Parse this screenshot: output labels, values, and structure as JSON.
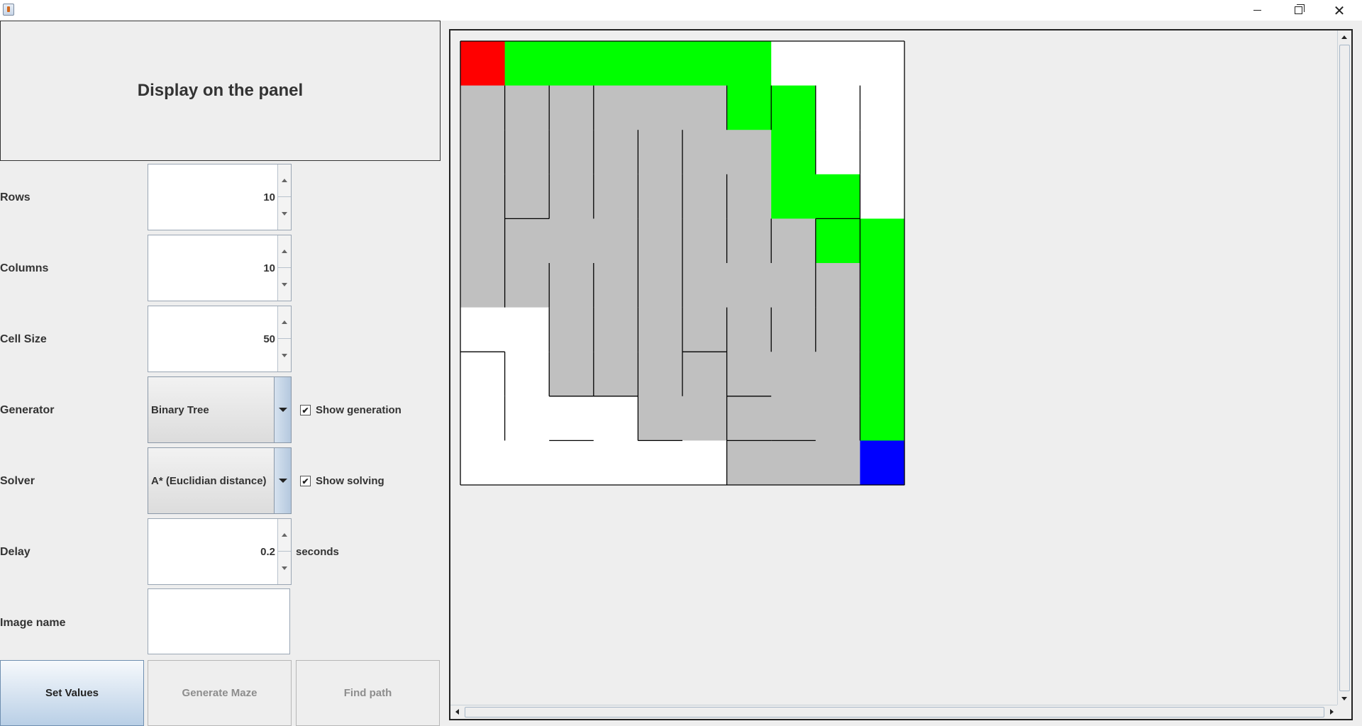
{
  "window": {
    "minimize_icon": "minimize-icon",
    "maximize_icon": "restore-icon",
    "close_icon": "close-icon"
  },
  "display_button": {
    "label": "Display on the panel"
  },
  "fields": {
    "rows": {
      "label": "Rows",
      "value": "10"
    },
    "columns": {
      "label": "Columns",
      "value": "10"
    },
    "cell_size": {
      "label": "Cell Size",
      "value": "50"
    },
    "generator": {
      "label": "Generator",
      "selected": "Binary Tree",
      "checkbox_label": "Show generation",
      "checked": true
    },
    "solver": {
      "label": "Solver",
      "selected": "A* (Euclidian distance)",
      "checkbox_label": "Show solving",
      "checked": true
    },
    "delay": {
      "label": "Delay",
      "value": "0.2",
      "unit": "seconds"
    },
    "image_name": {
      "label": "Image name",
      "value": ""
    }
  },
  "buttons": {
    "set_values": "Set Values",
    "generate_maze": "Generate Maze",
    "find_path": "Find path"
  },
  "maze": {
    "rows": 10,
    "cols": 10,
    "colors": {
      "start": "#ff0000",
      "end": "#0000ff",
      "path": "#00ff00",
      "visited": "#c0c0c0",
      "unvisited": "#ffffff",
      "wall": "#000000"
    },
    "start": [
      0,
      0
    ],
    "end": [
      9,
      9
    ],
    "path": [
      [
        0,
        1
      ],
      [
        0,
        2
      ],
      [
        0,
        3
      ],
      [
        0,
        4
      ],
      [
        0,
        5
      ],
      [
        0,
        6
      ],
      [
        1,
        6
      ],
      [
        1,
        7
      ],
      [
        2,
        7
      ],
      [
        3,
        7
      ],
      [
        3,
        8
      ],
      [
        4,
        8
      ],
      [
        4,
        9
      ],
      [
        5,
        9
      ],
      [
        6,
        9
      ],
      [
        7,
        9
      ],
      [
        8,
        9
      ]
    ],
    "visited": [
      [
        1,
        0
      ],
      [
        1,
        1
      ],
      [
        1,
        2
      ],
      [
        1,
        3
      ],
      [
        1,
        4
      ],
      [
        1,
        5
      ],
      [
        2,
        0
      ],
      [
        2,
        1
      ],
      [
        2,
        2
      ],
      [
        2,
        3
      ],
      [
        2,
        4
      ],
      [
        2,
        5
      ],
      [
        2,
        6
      ],
      [
        3,
        0
      ],
      [
        3,
        1
      ],
      [
        3,
        2
      ],
      [
        3,
        3
      ],
      [
        3,
        4
      ],
      [
        3,
        5
      ],
      [
        3,
        6
      ],
      [
        4,
        0
      ],
      [
        4,
        1
      ],
      [
        4,
        2
      ],
      [
        4,
        3
      ],
      [
        4,
        4
      ],
      [
        4,
        5
      ],
      [
        4,
        6
      ],
      [
        4,
        7
      ],
      [
        5,
        0
      ],
      [
        5,
        1
      ],
      [
        5,
        2
      ],
      [
        5,
        3
      ],
      [
        5,
        4
      ],
      [
        5,
        5
      ],
      [
        5,
        6
      ],
      [
        5,
        7
      ],
      [
        5,
        8
      ],
      [
        6,
        2
      ],
      [
        6,
        3
      ],
      [
        6,
        4
      ],
      [
        6,
        5
      ],
      [
        6,
        6
      ],
      [
        6,
        7
      ],
      [
        6,
        8
      ],
      [
        7,
        2
      ],
      [
        7,
        3
      ],
      [
        7,
        4
      ],
      [
        7,
        5
      ],
      [
        7,
        6
      ],
      [
        7,
        7
      ],
      [
        7,
        8
      ],
      [
        8,
        4
      ],
      [
        8,
        5
      ],
      [
        8,
        6
      ],
      [
        8,
        7
      ],
      [
        8,
        8
      ],
      [
        9,
        6
      ],
      [
        9,
        7
      ],
      [
        9,
        8
      ]
    ],
    "open_east": [
      [
        0,
        0
      ],
      [
        0,
        1
      ],
      [
        0,
        2
      ],
      [
        0,
        3
      ],
      [
        0,
        4
      ],
      [
        0,
        5
      ],
      [
        0,
        6
      ],
      [
        0,
        7
      ],
      [
        0,
        8
      ],
      [
        1,
        3
      ],
      [
        1,
        4
      ],
      [
        2,
        5
      ],
      [
        2,
        6
      ],
      [
        3,
        6
      ],
      [
        3,
        7
      ],
      [
        4,
        1
      ],
      [
        4,
        2
      ],
      [
        5,
        5
      ],
      [
        5,
        6
      ],
      [
        6,
        0
      ],
      [
        7,
        6
      ],
      [
        7,
        7
      ],
      [
        8,
        1
      ],
      [
        8,
        2
      ],
      [
        8,
        4
      ],
      [
        8,
        6
      ],
      [
        8,
        7
      ],
      [
        9,
        0
      ],
      [
        9,
        1
      ],
      [
        9,
        2
      ],
      [
        9,
        3
      ],
      [
        9,
        4
      ],
      [
        9,
        6
      ],
      [
        9,
        7
      ],
      [
        9,
        8
      ]
    ],
    "open_south": [
      [
        0,
        0
      ],
      [
        0,
        1
      ],
      [
        0,
        2
      ],
      [
        0,
        3
      ],
      [
        0,
        4
      ],
      [
        0,
        5
      ],
      [
        0,
        6
      ],
      [
        0,
        7
      ],
      [
        0,
        8
      ],
      [
        0,
        9
      ],
      [
        1,
        0
      ],
      [
        1,
        1
      ],
      [
        1,
        2
      ],
      [
        1,
        3
      ],
      [
        1,
        4
      ],
      [
        1,
        5
      ],
      [
        1,
        6
      ],
      [
        1,
        7
      ],
      [
        1,
        8
      ],
      [
        1,
        9
      ],
      [
        2,
        0
      ],
      [
        2,
        1
      ],
      [
        2,
        2
      ],
      [
        2,
        3
      ],
      [
        2,
        4
      ],
      [
        2,
        5
      ],
      [
        2,
        6
      ],
      [
        2,
        7
      ],
      [
        2,
        8
      ],
      [
        2,
        9
      ],
      [
        3,
        0
      ],
      [
        3,
        2
      ],
      [
        3,
        3
      ],
      [
        3,
        4
      ],
      [
        3,
        5
      ],
      [
        3,
        6
      ],
      [
        3,
        7
      ],
      [
        3,
        9
      ],
      [
        4,
        0
      ],
      [
        4,
        1
      ],
      [
        4,
        2
      ],
      [
        4,
        3
      ],
      [
        4,
        4
      ],
      [
        4,
        5
      ],
      [
        4,
        6
      ],
      [
        4,
        7
      ],
      [
        4,
        8
      ],
      [
        4,
        9
      ],
      [
        5,
        0
      ],
      [
        5,
        1
      ],
      [
        5,
        2
      ],
      [
        5,
        3
      ],
      [
        5,
        4
      ],
      [
        5,
        5
      ],
      [
        5,
        6
      ],
      [
        5,
        7
      ],
      [
        5,
        8
      ],
      [
        5,
        9
      ],
      [
        6,
        1
      ],
      [
        6,
        2
      ],
      [
        6,
        3
      ],
      [
        6,
        4
      ],
      [
        6,
        6
      ],
      [
        6,
        7
      ],
      [
        6,
        8
      ],
      [
        6,
        9
      ],
      [
        7,
        0
      ],
      [
        7,
        1
      ],
      [
        7,
        4
      ],
      [
        7,
        5
      ],
      [
        7,
        7
      ],
      [
        7,
        8
      ],
      [
        7,
        9
      ],
      [
        8,
        0
      ],
      [
        8,
        1
      ],
      [
        8,
        3
      ],
      [
        8,
        5
      ],
      [
        8,
        8
      ],
      [
        8,
        9
      ]
    ]
  }
}
